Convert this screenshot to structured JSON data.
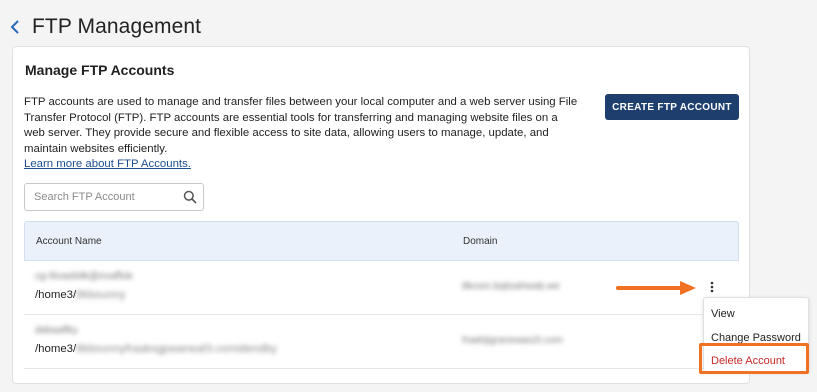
{
  "header": {
    "title": "FTP Management"
  },
  "card": {
    "title": "Manage FTP Accounts",
    "description": "FTP accounts are used to manage and transfer files between your local computer and a web server using File Transfer Protocol (FTP). FTP accounts are essential tools for transferring and managing website files on a web server. They provide secure and flexible access to site data, allowing users to manage, update, and maintain websites efficiently.",
    "learn_more": "Learn more about FTP Accounts.",
    "create_button": "CREATE FTP ACCOUNT",
    "search_placeholder": "Search FTP Account"
  },
  "table": {
    "columns": [
      "Account Name",
      "Domain"
    ],
    "rows": [
      {
        "name": "cg-9ivaeb9k@evaffisk",
        "path_prefix": "/home3/",
        "path_rest": "8kbounny",
        "domain": "8kcsm.bqtisahwab.we"
      },
      {
        "name": "dabaaflky",
        "path_prefix": "/home3/",
        "path_rest": "8kbounnyfraaksgpwaneaf3.comidendby",
        "domain": "fraahjigranewas2t.com"
      }
    ]
  },
  "menu": {
    "items": [
      "View",
      "Change Password",
      "Delete Account"
    ]
  },
  "colors": {
    "accent": "#1e3e6e",
    "link": "#1d4e8f",
    "danger": "#c62828",
    "annotation": "#f07122",
    "table_header_bg": "#eaf1fb"
  },
  "icons": {
    "back": "chevron-left-icon",
    "search": "search-icon",
    "row_menu": "kebab-vertical-icon",
    "annotation_arrow": "arrow-right-icon"
  }
}
